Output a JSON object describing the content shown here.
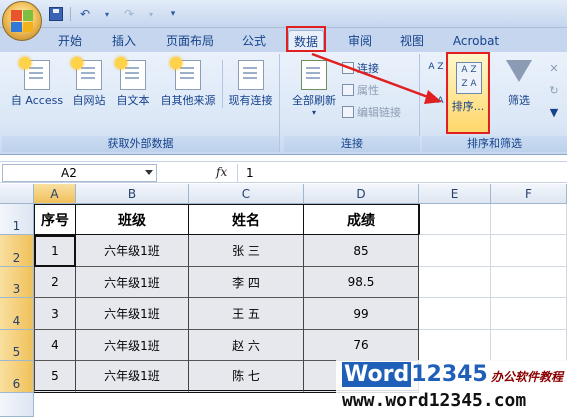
{
  "qat": {
    "save": "save-icon",
    "undo": "undo-icon",
    "redo": "redo-icon",
    "customize": "customize-icon"
  },
  "tabs": [
    "开始",
    "插入",
    "页面布局",
    "公式",
    "数据",
    "审阅",
    "视图",
    "Acrobat"
  ],
  "active_tab": "数据",
  "ribbon": {
    "external": {
      "label": "获取外部数据",
      "buttons": [
        "自 Access",
        "自网站",
        "自文本",
        "自其他来源",
        "现有连接"
      ]
    },
    "connections": {
      "label": "连接",
      "refresh_all": "全部刷新",
      "items": [
        "连接",
        "属性",
        "编辑链接"
      ]
    },
    "sort_filter": {
      "label": "排序和筛选",
      "sort": "排序...",
      "filter": "筛选",
      "az_icon": "A Z",
      "za_icon": "Z A"
    }
  },
  "formula_bar": {
    "name_box": "A2",
    "fx": "fx",
    "value": "1"
  },
  "columns": [
    "A",
    "B",
    "C",
    "D",
    "E",
    "F"
  ],
  "rows": [
    "1",
    "2",
    "3",
    "4",
    "5",
    "6"
  ],
  "table": {
    "headers": [
      "序号",
      "班级",
      "姓名",
      "成绩"
    ],
    "rows": [
      [
        "1",
        "六年级1班",
        "张 三",
        "85"
      ],
      [
        "2",
        "六年级1班",
        "李 四",
        "98.5"
      ],
      [
        "3",
        "六年级1班",
        "王 五",
        "99"
      ],
      [
        "4",
        "六年级1班",
        "赵 六",
        "76"
      ],
      [
        "5",
        "六年级1班",
        "陈 七",
        ""
      ]
    ]
  },
  "watermark": {
    "brand_a": "Word",
    "brand_b": "12345",
    "side": "办公软件教程",
    "url": "www.word12345.com"
  },
  "colors": {
    "highlight": "#e02020",
    "tab_bg": "#c5d6ee",
    "ribbon_bg": "#dbe7f6",
    "cell_fill": "#e6e8ee"
  }
}
